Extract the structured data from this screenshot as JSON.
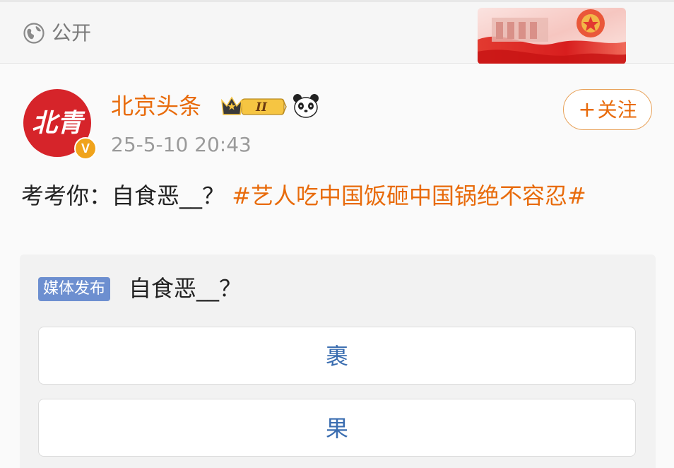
{
  "visibility": {
    "icon": "globe-icon",
    "label": "公开"
  },
  "post": {
    "author": "北京头条",
    "avatar_text": "北青",
    "verified_mark": "V",
    "badge_icon": "crown-level-badge",
    "badge_level": "II",
    "emoji_icon": "panda-icon",
    "time": "25-5-10 20:43",
    "follow_label": "关注",
    "follow_plus": "+",
    "text": "考考你：自食恶__？",
    "hashtag": "#艺人吃中国饭砸中国锅绝不容忍#"
  },
  "poll": {
    "badge": "媒体发布",
    "question": "自食恶__？",
    "options": [
      "裹",
      "果"
    ]
  },
  "colors": {
    "accent": "#e86b0b",
    "option_text": "#3a6db0",
    "media_badge": "#6d8fd0",
    "avatar_red": "#d6242a",
    "verified": "#f0a31b"
  }
}
